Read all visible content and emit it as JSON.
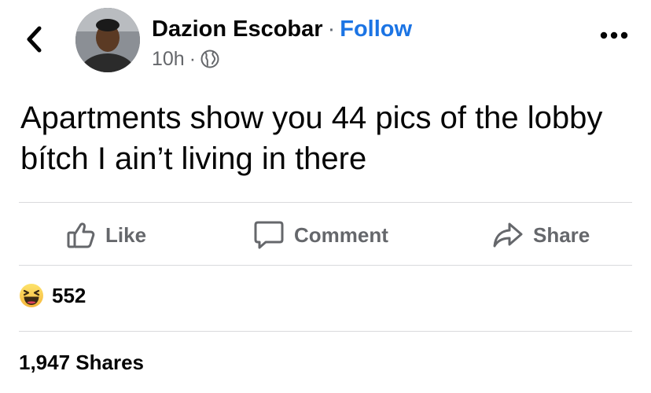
{
  "header": {
    "back_icon": "chevron-left-icon",
    "author_name": "Dazion Escobar",
    "separator": "·",
    "follow_label": "Follow",
    "time_ago": "10h",
    "privacy_icon": "globe-icon",
    "more_icon": "more-horizontal-icon"
  },
  "post": {
    "text": "Apartments show you 44 pics of the lobby bítch I ain’t living in there"
  },
  "actions": {
    "like_label": "Like",
    "comment_label": "Comment",
    "share_label": "Share"
  },
  "reactions": {
    "emoji_icon": "laughing-emoji-icon",
    "count": "552"
  },
  "shares": {
    "label": "1,947 Shares"
  },
  "colors": {
    "link_blue": "#1b74e4",
    "secondary_text": "#65676b",
    "divider": "#d9dadc"
  }
}
